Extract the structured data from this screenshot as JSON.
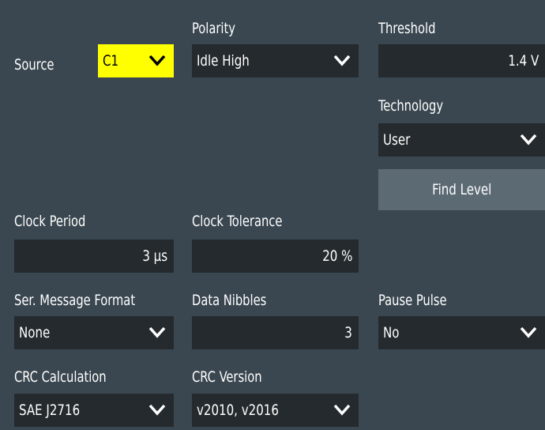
{
  "source": {
    "label": "Source",
    "value": "C1"
  },
  "polarity": {
    "label": "Polarity",
    "value": "Idle High"
  },
  "threshold": {
    "label": "Threshold",
    "value": "1.4 V"
  },
  "technology": {
    "label": "Technology",
    "value": "User"
  },
  "find_level": {
    "label": "Find Level"
  },
  "clock_period": {
    "label": "Clock Period",
    "value": "3 µs"
  },
  "clock_tolerance": {
    "label": "Clock Tolerance",
    "value": "20 %"
  },
  "ser_message_format": {
    "label": "Ser. Message Format",
    "value": "None"
  },
  "data_nibbles": {
    "label": "Data Nibbles",
    "value": "3"
  },
  "pause_pulse": {
    "label": "Pause Pulse",
    "value": "No"
  },
  "crc_calculation": {
    "label": "CRC Calculation",
    "value": "SAE J2716"
  },
  "crc_version": {
    "label": "CRC Version",
    "value": "v2010, v2016"
  },
  "colors": {
    "background": "#3a4750",
    "field": "#242a2e",
    "highlight": "#ffff00",
    "button": "#5c6a74"
  }
}
